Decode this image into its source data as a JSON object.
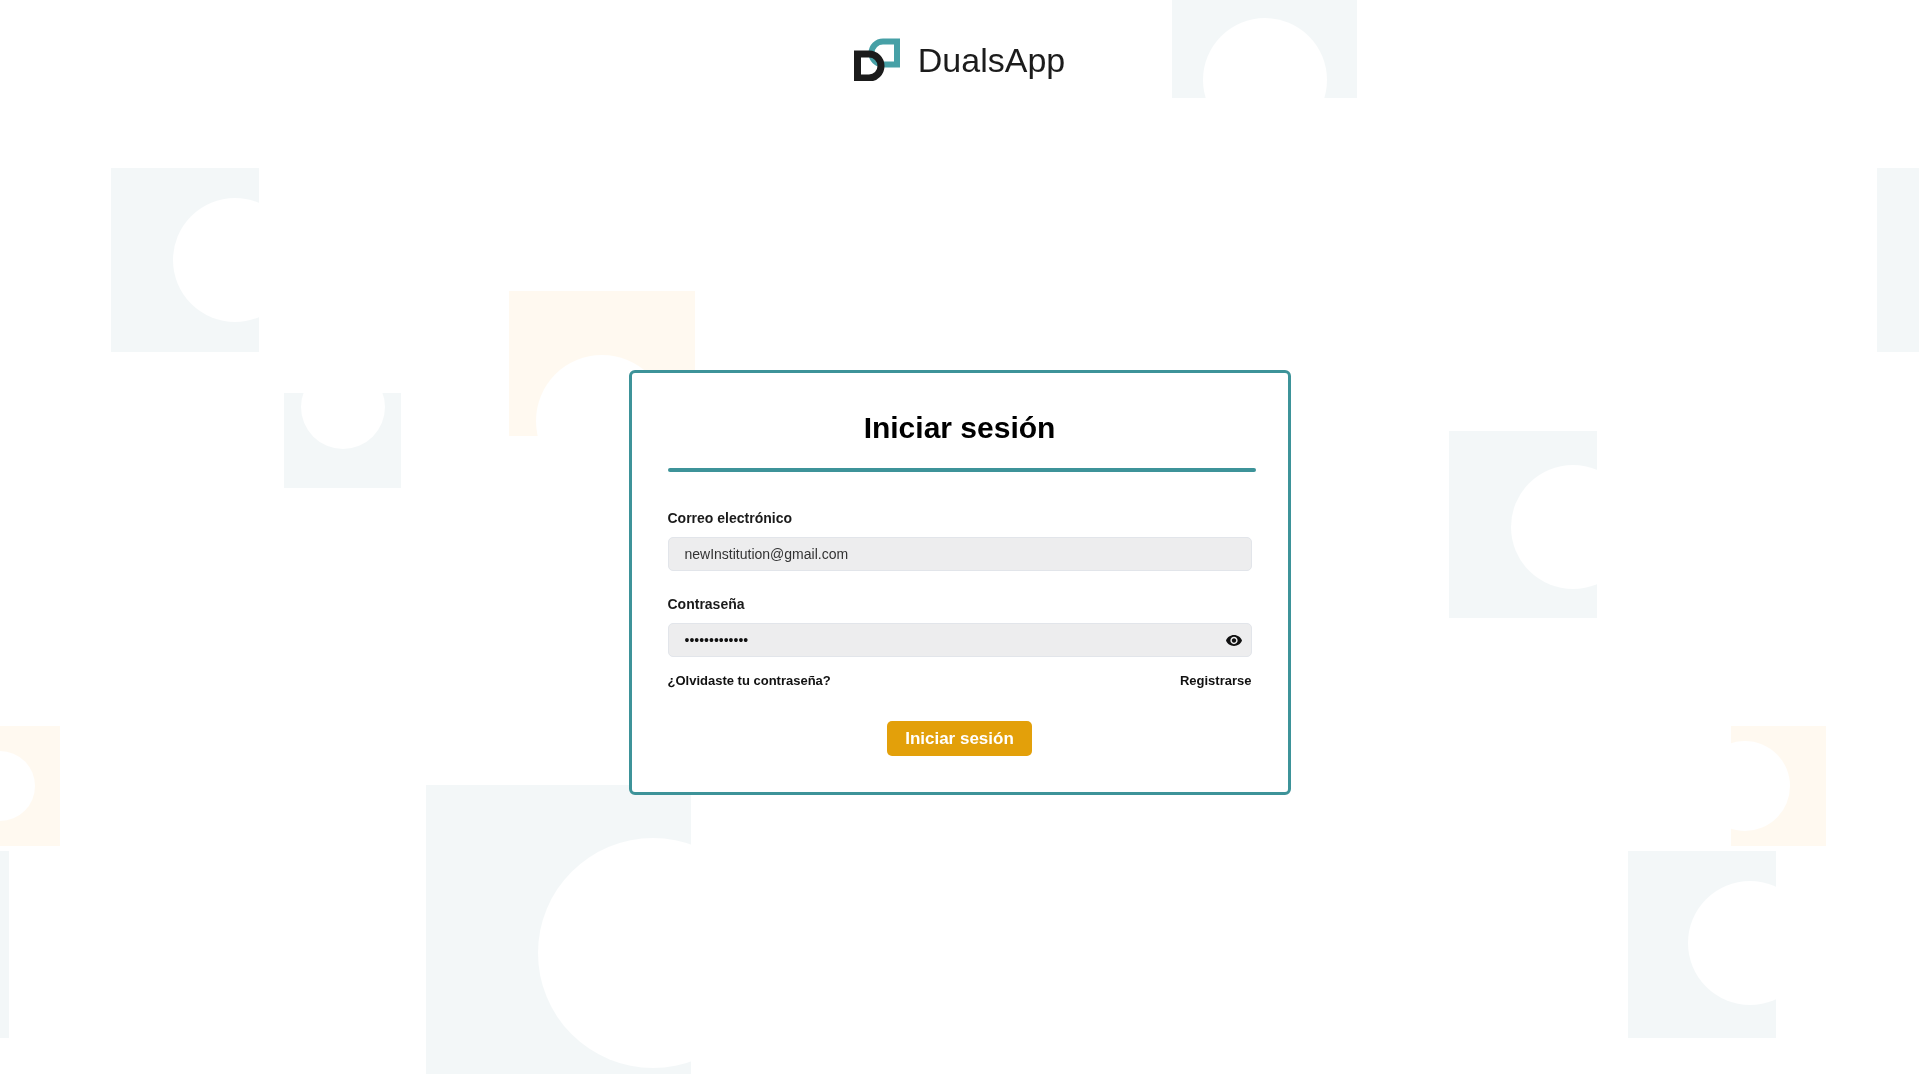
{
  "header": {
    "app_name": "DualsApp"
  },
  "login_form": {
    "title": "Iniciar sesión",
    "fields": [
      {
        "kind": "email",
        "label": "Correo electrónico",
        "value": "newInstitution@gmail.com"
      },
      {
        "kind": "password",
        "label": "Contraseña",
        "value": "•••••••••••••"
      }
    ],
    "links": [
      "¿Olvidaste tu contraseña?",
      "Registrarse"
    ],
    "submit_button": "Iniciar sesión"
  }
}
